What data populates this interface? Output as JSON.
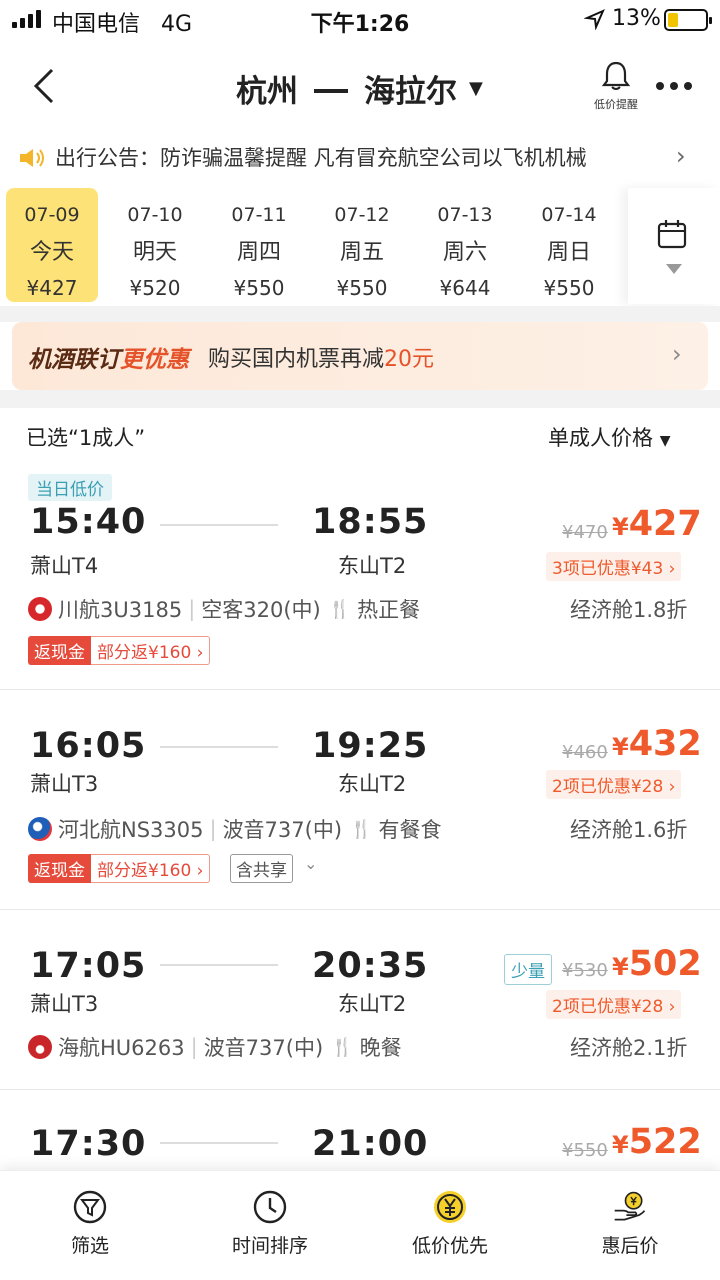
{
  "status_bar": {
    "carrier": "中国电信",
    "network": "4G",
    "time": "下午1:26",
    "battery": "13%"
  },
  "header": {
    "origin": "杭州",
    "destination": "海拉尔",
    "bell_label": "低价提醒"
  },
  "notice": {
    "text": "出行公告：防诈骗温馨提醒  凡有冒充航空公司以飞机机械"
  },
  "dates": [
    {
      "date": "07-09",
      "day": "今天",
      "price": "¥427",
      "selected": true
    },
    {
      "date": "07-10",
      "day": "明天",
      "price": "¥520"
    },
    {
      "date": "07-11",
      "day": "周四",
      "price": "¥550"
    },
    {
      "date": "07-12",
      "day": "周五",
      "price": "¥550"
    },
    {
      "date": "07-13",
      "day": "周六",
      "price": "¥644"
    },
    {
      "date": "07-14",
      "day": "周日",
      "price": "¥550"
    }
  ],
  "promo": {
    "title_a": "机酒联订",
    "title_b": "更优惠",
    "text_a": "购买国内机票再减",
    "text_b": "20元"
  },
  "list_header": {
    "selected": "已选“1成人”",
    "sort": "单成人价格"
  },
  "flights": [
    {
      "tag": "当日低价",
      "dep_time": "15:40",
      "dep_airport": "萧山T4",
      "arr_time": "18:55",
      "arr_airport": "东山T2",
      "orig_price": "¥470",
      "price": "427",
      "discount": "3项已优惠¥43",
      "airline": "川航3U3185",
      "aircraft": "空客320(中)",
      "meal": "热正餐",
      "cabin": "经济舱1.8折",
      "cash_a": "返现金",
      "cash_b": "部分返¥160"
    },
    {
      "dep_time": "16:05",
      "dep_airport": "萧山T3",
      "arr_time": "19:25",
      "arr_airport": "东山T2",
      "orig_price": "¥460",
      "price": "432",
      "discount": "2项已优惠¥28",
      "airline": "河北航NS3305",
      "aircraft": "波音737(中)",
      "meal": "有餐食",
      "cabin": "经济舱1.6折",
      "cash_a": "返现金",
      "cash_b": "部分返¥160",
      "share": "含共享"
    },
    {
      "dep_time": "17:05",
      "dep_airport": "萧山T3",
      "arr_time": "20:35",
      "arr_airport": "东山T2",
      "few": "少量",
      "orig_price": "¥530",
      "price": "502",
      "discount": "2项已优惠¥28",
      "airline": "海航HU6263",
      "aircraft": "波音737(中)",
      "meal": "晚餐",
      "cabin": "经济舱2.1折"
    },
    {
      "dep_time": "17:30",
      "arr_time": "21:00",
      "orig_price": "¥550",
      "price": "522"
    }
  ],
  "bottom_bar": {
    "filter": "筛选",
    "time_sort": "时间排序",
    "low_price": "低价优先",
    "deal_price": "惠后价"
  },
  "colors": {
    "accent": "#ef5a2c",
    "selected_date": "#fde377",
    "tag_teal": "#3ba0b4"
  }
}
